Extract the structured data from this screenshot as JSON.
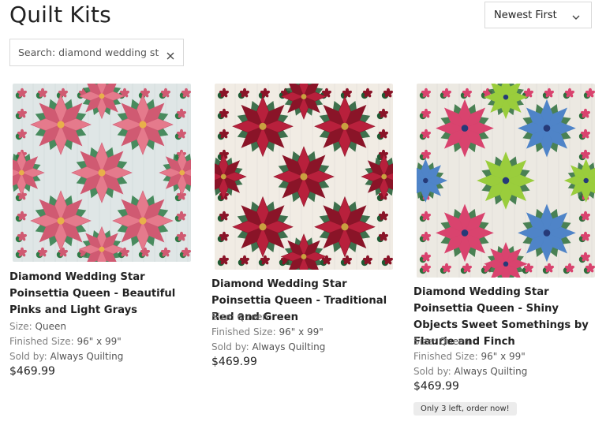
{
  "header": {
    "title": "Quilt Kits"
  },
  "sort": {
    "selected": "Newest First"
  },
  "search": {
    "value": "Search: diamond wedding star"
  },
  "labels": {
    "size": "Size:",
    "finished": "Finished Size:",
    "sold_by": "Sold by:"
  },
  "products": [
    {
      "title": "Diamond Wedding Star Poinsettia Queen - Beautiful Pinks and Light Grays",
      "size": "Queen",
      "finished_size": "96\" x 99\"",
      "sold_by": "Always Quilting",
      "price": "$469.99",
      "colors": {
        "bg": "#dfe6e6",
        "petal": "#e57a8c",
        "petal_dark": "#d05a72",
        "center": "#e8b04a",
        "leaf": "#2e7a45"
      }
    },
    {
      "title": "Diamond Wedding Star Poinsettia Queen - Traditional Red and Green",
      "size": "Queen",
      "finished_size": "96\" x 99\"",
      "sold_by": "Always Quilting",
      "price": "$469.99",
      "colors": {
        "bg": "#f1ece4",
        "petal": "#b8203c",
        "petal_dark": "#8a1428",
        "center": "#c9a040",
        "leaf": "#1f5a33"
      }
    },
    {
      "title": "Diamond Wedding Star Poinsettia Queen - Shiny Objects Sweet Somethings by Flaurie and Finch",
      "size": "Queen",
      "finished_size": "96\" x 99\"",
      "sold_by": "Always Quilting",
      "price": "$469.99",
      "badge": "Only 3 left, order now!",
      "colors": {
        "bg": "#ece9e2",
        "petal": "#d9436e",
        "petal_alt1": "#4f84c8",
        "petal_alt2": "#9acd3c",
        "center": "#263a78",
        "leaf": "#2e6e3b"
      }
    }
  ]
}
